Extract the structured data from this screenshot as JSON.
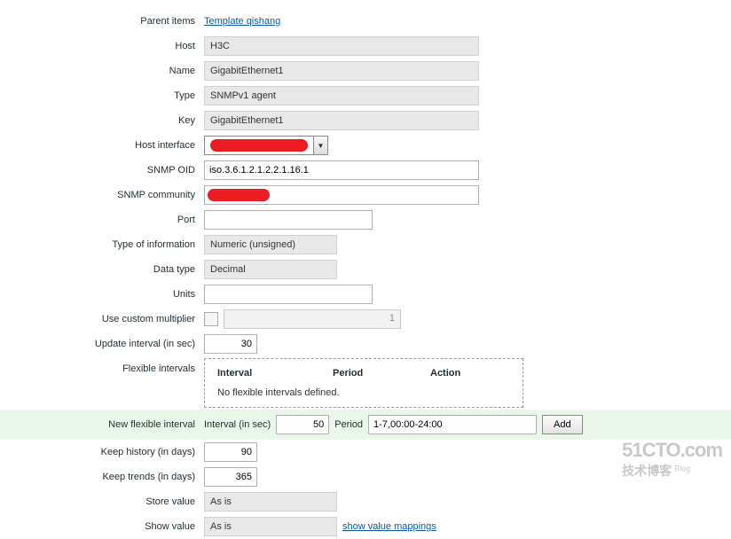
{
  "labels": {
    "parent_items": "Parent items",
    "host": "Host",
    "name": "Name",
    "type": "Type",
    "key": "Key",
    "host_interface": "Host interface",
    "snmp_oid": "SNMP OID",
    "snmp_community": "SNMP community",
    "port": "Port",
    "type_of_info": "Type of information",
    "data_type": "Data type",
    "units": "Units",
    "custom_mult": "Use custom multiplier",
    "update_interval": "Update interval (in sec)",
    "flex_intervals": "Flexible intervals",
    "new_flex": "New flexible interval",
    "keep_history": "Keep history (in days)",
    "keep_trends": "Keep trends (in days)",
    "store_value": "Store value",
    "show_value": "Show value"
  },
  "values": {
    "parent_link": "Template qishang",
    "host": "H3C",
    "name": "GigabitEthernet1",
    "type": "SNMPv1 agent",
    "key": "GigabitEthernet1",
    "snmp_oid": "iso.3.6.1.2.1.2.2.1.16.1",
    "type_of_info": "Numeric (unsigned)",
    "data_type": "Decimal",
    "multiplier": "1",
    "update_interval": "30",
    "keep_history": "90",
    "keep_trends": "365",
    "store_value": "As is",
    "show_value": "As is"
  },
  "flex": {
    "col_interval": "Interval",
    "col_period": "Period",
    "col_action": "Action",
    "empty": "No flexible intervals defined."
  },
  "newflex": {
    "interval_label": "Interval (in sec)",
    "interval_value": "50",
    "period_label": "Period",
    "period_value": "1-7,00:00-24:00",
    "add": "Add"
  },
  "links": {
    "show_value_mappings": "show value mappings"
  },
  "watermark": {
    "line1": "51CTO.com",
    "line2": "技术博客",
    "blog": "Blog"
  }
}
